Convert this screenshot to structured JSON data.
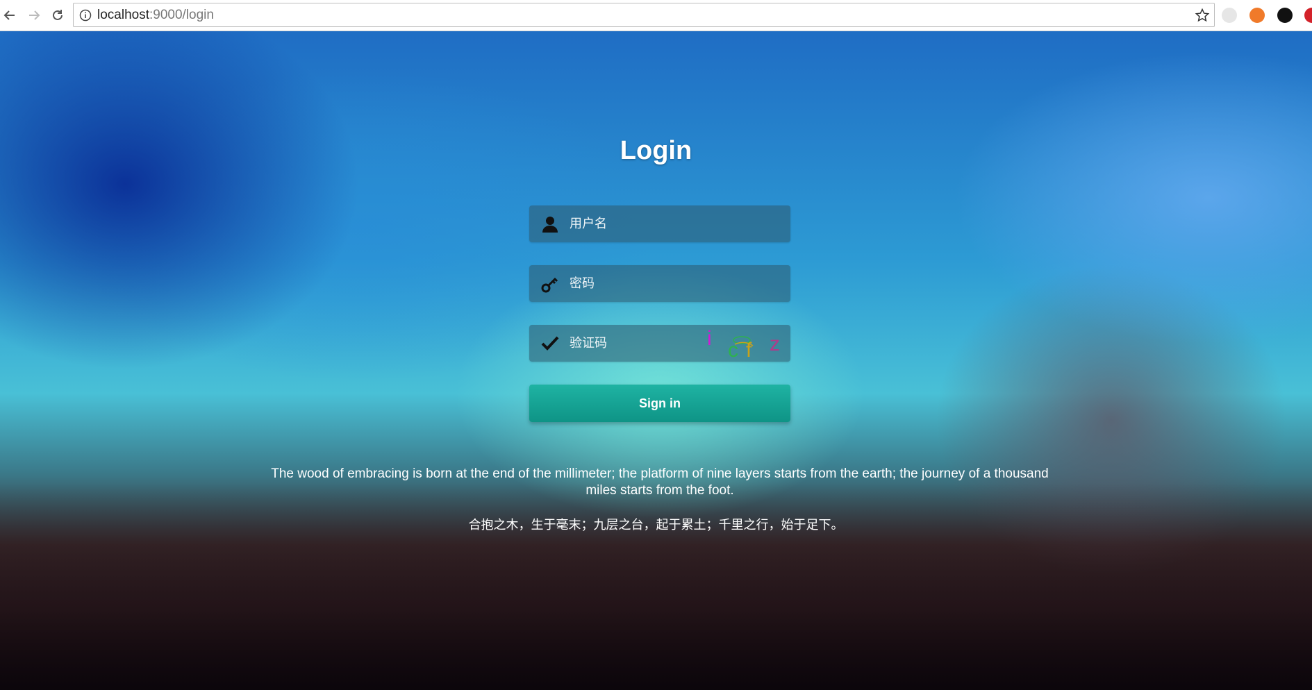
{
  "browser": {
    "url_host": "localhost",
    "url_path": ":9000/login"
  },
  "login": {
    "title": "Login",
    "username_placeholder": "用户名",
    "password_placeholder": "密码",
    "captcha_placeholder": "验证码",
    "captcha_chars": [
      "i",
      "c",
      "f",
      "z"
    ],
    "signin_label": "Sign in"
  },
  "quote": {
    "en": "The wood of embracing is born at the end of the millimeter; the platform of nine layers starts from the earth; the journey of a thousand miles starts from the foot.",
    "cn": "合抱之木，生于毫末；九层之台，起于累土；千里之行，始于足下。"
  },
  "colors": {
    "signin_button": "#13a394",
    "field_bg": "#2d5a6e",
    "captcha_i": "#d21ad6",
    "captcha_c": "#2db34d",
    "captcha_f": "#c9a21a",
    "captcha_z": "#b03a8a"
  }
}
